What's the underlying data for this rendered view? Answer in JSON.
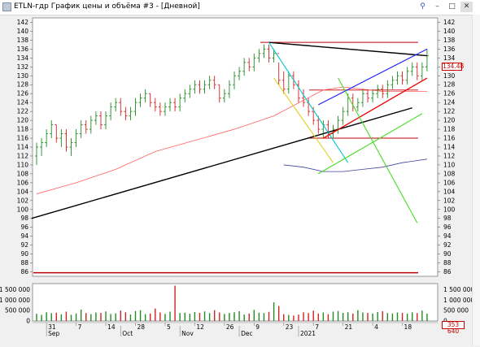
{
  "window": {
    "title": "ETLN-гдр График цены и объёма #3 - [Дневной]",
    "buttons": [
      "pin-icon",
      "minimize-icon",
      "maximize-icon",
      "close-icon"
    ]
  },
  "price_axis": {
    "ticks": [
      "142",
      "140",
      "138",
      "136",
      "134",
      "132",
      "130",
      "128",
      "126",
      "124",
      "122",
      "120",
      "118",
      "116",
      "114",
      "112",
      "110",
      "108",
      "106",
      "104",
      "102",
      "100",
      "98",
      "96",
      "94",
      "92",
      "90",
      "88",
      "86"
    ],
    "current_price": "134.48"
  },
  "volume_axis": {
    "ticks": [
      "1 500 000",
      "1 000 000",
      "500 000",
      "0"
    ],
    "current_volume": "353 640"
  },
  "time_axis": {
    "day_labels": [
      "31",
      "7",
      "14",
      "28",
      "5",
      "12",
      "26",
      "9",
      "23",
      "7",
      "21",
      "4",
      "18"
    ],
    "month_labels": [
      "Sep",
      "Oct",
      "Nov",
      "Dec",
      "2021"
    ]
  },
  "colors": {
    "up_candle": "#228b22",
    "down_candle": "#d22222",
    "support_line": "#c00000",
    "trend_main": "#000000",
    "trend_blue": "#1a1aff",
    "trend_red": "#ee0000",
    "trend_cyan": "#00c8d0",
    "trend_yellow": "#e0d020",
    "trend_green": "#44dd22",
    "ma_long": "#ff6060",
    "ma_blue": "#4040a0"
  },
  "chart_data": {
    "type": "candlestick",
    "price_range": [
      85,
      143
    ],
    "volume_range": [
      0,
      1800000
    ],
    "candles": [
      [
        112,
        115,
        110,
        114
      ],
      [
        114,
        116,
        112,
        115
      ],
      [
        115,
        118,
        114,
        117
      ],
      [
        117,
        120,
        116,
        119
      ],
      [
        119,
        119,
        115,
        116
      ],
      [
        116,
        118,
        114,
        117
      ],
      [
        117,
        118,
        113,
        114
      ],
      [
        114,
        116,
        112,
        115
      ],
      [
        115,
        118,
        114,
        117
      ],
      [
        117,
        120,
        116,
        119
      ],
      [
        119,
        120,
        117,
        118
      ],
      [
        118,
        121,
        117,
        120
      ],
      [
        120,
        122,
        119,
        121
      ],
      [
        121,
        122,
        118,
        119
      ],
      [
        119,
        122,
        118,
        121
      ],
      [
        121,
        124,
        120,
        123
      ],
      [
        123,
        125,
        122,
        124
      ],
      [
        124,
        125,
        121,
        122
      ],
      [
        122,
        123,
        120,
        121
      ],
      [
        121,
        123,
        120,
        122
      ],
      [
        122,
        125,
        121,
        124
      ],
      [
        124,
        126,
        123,
        125
      ],
      [
        125,
        127,
        124,
        126
      ],
      [
        126,
        126,
        123,
        124
      ],
      [
        124,
        125,
        122,
        123
      ],
      [
        123,
        124,
        121,
        122
      ],
      [
        122,
        124,
        121,
        123
      ],
      [
        123,
        125,
        122,
        124
      ],
      [
        124,
        125,
        122,
        123
      ],
      [
        123,
        126,
        122,
        125
      ],
      [
        125,
        127,
        124,
        126
      ],
      [
        126,
        128,
        125,
        127
      ],
      [
        127,
        129,
        126,
        128
      ],
      [
        128,
        129,
        126,
        127
      ],
      [
        127,
        129,
        126,
        128
      ],
      [
        128,
        130,
        127,
        129
      ],
      [
        129,
        130,
        127,
        128
      ],
      [
        128,
        128,
        124,
        125
      ],
      [
        125,
        127,
        124,
        126
      ],
      [
        126,
        129,
        125,
        128
      ],
      [
        128,
        131,
        127,
        130
      ],
      [
        130,
        132,
        129,
        131
      ],
      [
        131,
        134,
        130,
        133
      ],
      [
        133,
        134,
        131,
        132
      ],
      [
        132,
        135,
        131,
        134
      ],
      [
        134,
        136,
        133,
        135
      ],
      [
        135,
        137,
        134,
        136
      ],
      [
        136,
        137,
        133,
        134
      ],
      [
        134,
        136,
        133,
        135
      ],
      [
        135,
        133,
        128,
        129
      ],
      [
        129,
        131,
        126,
        127
      ],
      [
        127,
        131,
        126,
        130
      ],
      [
        130,
        131,
        127,
        128
      ],
      [
        128,
        129,
        124,
        125
      ],
      [
        125,
        127,
        123,
        124
      ],
      [
        124,
        125,
        121,
        122
      ],
      [
        122,
        123,
        119,
        120
      ],
      [
        120,
        121,
        117,
        118
      ],
      [
        118,
        120,
        116,
        119
      ],
      [
        119,
        120,
        116,
        117
      ],
      [
        117,
        119,
        116,
        118
      ],
      [
        118,
        121,
        117,
        120
      ],
      [
        120,
        123,
        119,
        122
      ],
      [
        122,
        126,
        121,
        125
      ],
      [
        125,
        126,
        122,
        123
      ],
      [
        123,
        125,
        122,
        124
      ],
      [
        124,
        127,
        123,
        126
      ],
      [
        126,
        127,
        124,
        125
      ],
      [
        125,
        127,
        124,
        126
      ],
      [
        126,
        128,
        125,
        127
      ],
      [
        127,
        128,
        125,
        126
      ],
      [
        126,
        129,
        125,
        128
      ],
      [
        128,
        130,
        127,
        129
      ],
      [
        129,
        131,
        128,
        130
      ],
      [
        130,
        131,
        128,
        129
      ],
      [
        129,
        132,
        128,
        131
      ],
      [
        131,
        133,
        130,
        132
      ],
      [
        132,
        133,
        129,
        130
      ],
      [
        130,
        133,
        129,
        132
      ],
      [
        132,
        136,
        131,
        134.5
      ]
    ],
    "volumes": [
      350000,
      300000,
      420000,
      380000,
      400000,
      320000,
      450000,
      300000,
      360000,
      550000,
      380000,
      330000,
      410000,
      390000,
      460000,
      340000,
      370000,
      500000,
      420000,
      310000,
      480000,
      520000,
      330000,
      360000,
      600000,
      410000,
      340000,
      450000,
      1700000,
      380000,
      400000,
      350000,
      430000,
      390000,
      460000,
      380000,
      520000,
      410000,
      340000,
      390000,
      420000,
      470000,
      310000,
      360000,
      540000,
      400000,
      380000,
      440000,
      900000,
      720000,
      330000,
      290000,
      260000,
      310000,
      420000,
      380000,
      500000,
      360000,
      410000,
      330000,
      450000,
      480000,
      390000,
      420000,
      360000,
      520000,
      410000,
      390000,
      360000,
      430000,
      470000,
      380000,
      360000,
      410000,
      390000,
      350000,
      420000,
      380000,
      500000,
      353640
    ]
  }
}
